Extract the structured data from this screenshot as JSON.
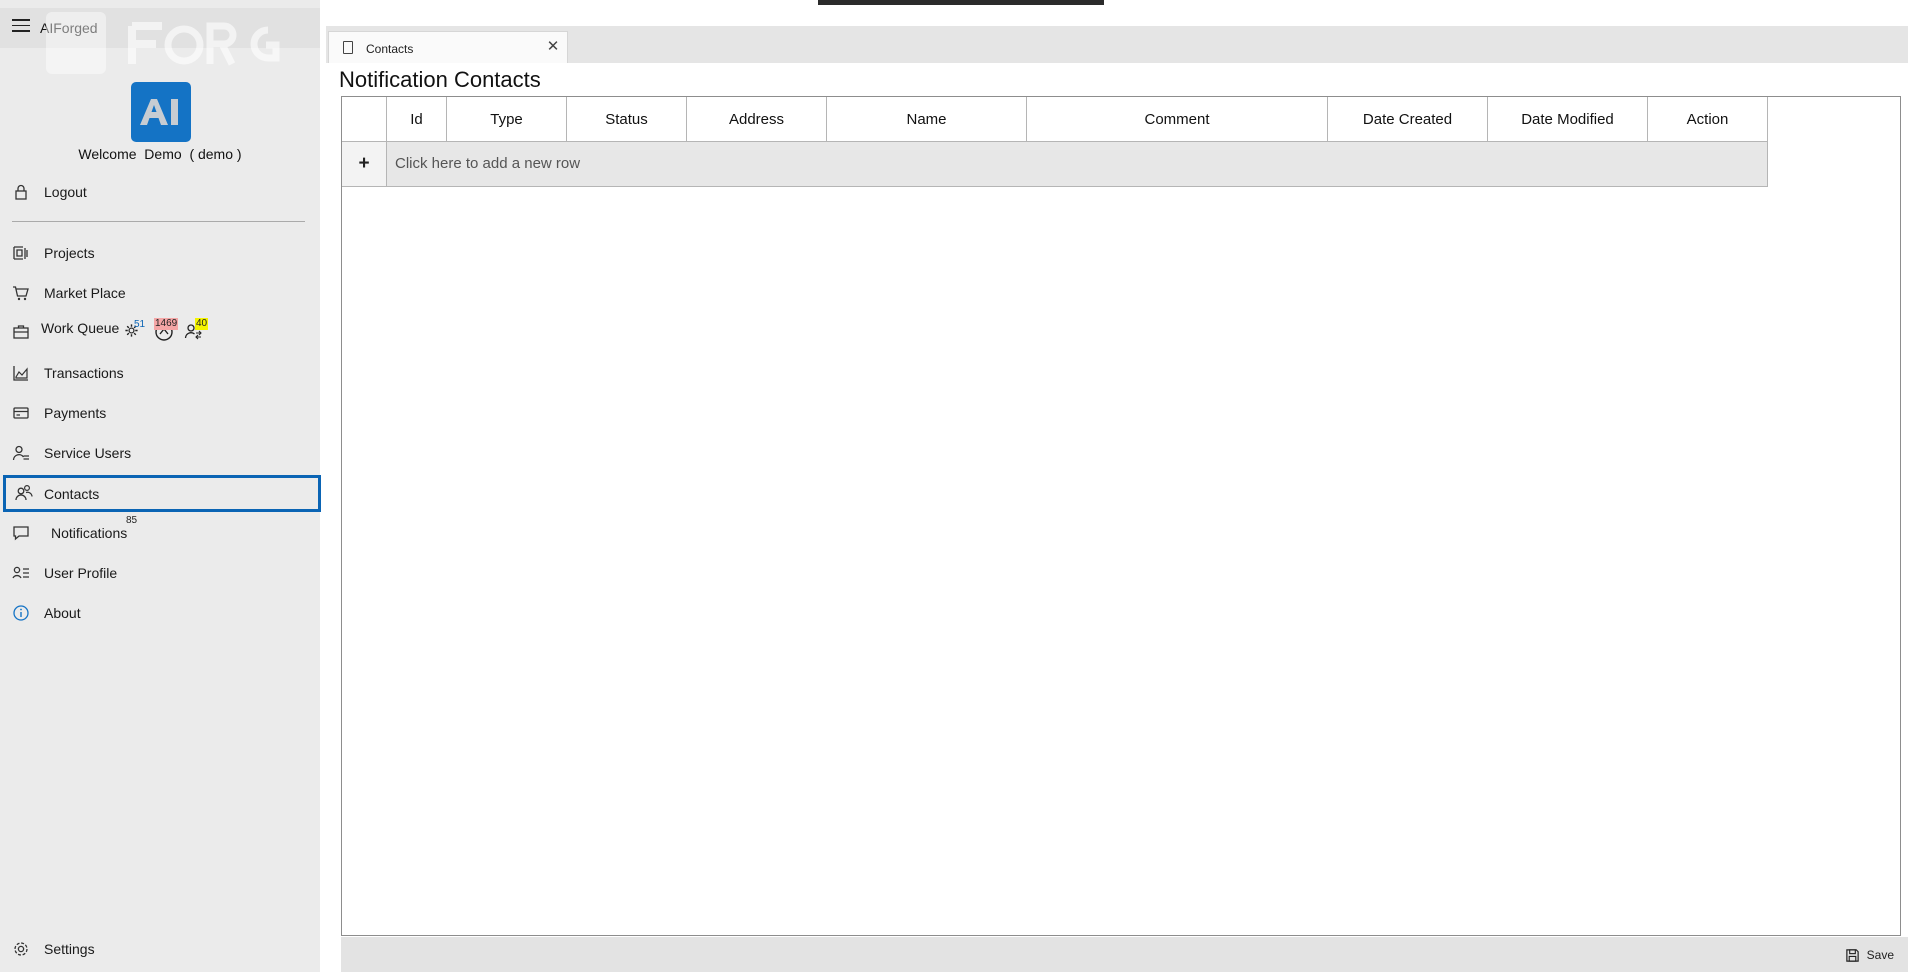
{
  "app": {
    "title": "AIForged"
  },
  "user": {
    "welcome": "Welcome",
    "first_name": "Demo",
    "login": "( demo )"
  },
  "nav": {
    "logout": "Logout",
    "projects": "Projects",
    "marketplace": "Market Place",
    "work_queue": "Work Queue",
    "work_queue_badges": {
      "processing": "51",
      "errors": "1469",
      "assigned": "40"
    },
    "transactions": "Transactions",
    "payments": "Payments",
    "service_users": "Service Users",
    "contacts": "Contacts",
    "notifications": "Notifications",
    "notifications_count": "85",
    "user_profile": "User Profile",
    "about": "About",
    "settings": "Settings"
  },
  "tab": {
    "label": "Contacts"
  },
  "page": {
    "title": "Notification Contacts"
  },
  "grid": {
    "columns": [
      "",
      "Id",
      "Type",
      "Status",
      "Address",
      "Name",
      "Comment",
      "Date Created",
      "Date Modified",
      "Action"
    ],
    "add_row_plus": "+",
    "add_row_text": "Click here to add a new row",
    "rows": []
  },
  "footer": {
    "save_label": "Save"
  },
  "colors": {
    "accent": "#1473c5",
    "selection_border": "#0a64b4",
    "sidebar_bg": "#ebebeb"
  }
}
